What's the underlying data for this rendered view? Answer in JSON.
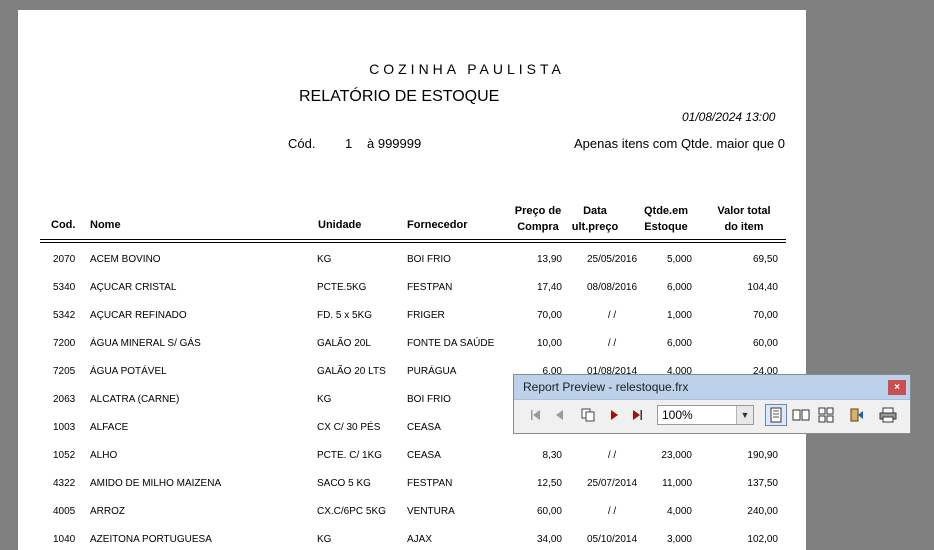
{
  "report": {
    "company": "COZINHA PAULISTA",
    "title": "RELATÓRIO DE ESTOQUE",
    "timestamp": "01/08/2024 13:00",
    "criteria_label": "Cód.",
    "criteria_from": "1",
    "criteria_to": "à 999999",
    "criteria_note": "Apenas itens com Qtde. maior que 0",
    "headers": {
      "cod": "Cod.",
      "nome": "Nome",
      "unidade": "Unidade",
      "fornecedor": "Fornecedor",
      "preco_1": "Preço de",
      "preco_2": "Compra",
      "data_1": "Data",
      "data_2": "ult.preço",
      "qtde_1": "Qtde.em",
      "qtde_2": "Estoque",
      "valor_1": "Valor total",
      "valor_2": "do item"
    },
    "rows": [
      {
        "cod": "2070",
        "nome": "ACEM BOVINO",
        "unidade": "KG",
        "fornecedor": "BOI FRIO",
        "preco": "13,90",
        "data": "25/05/2016",
        "qtde": "5,000",
        "valor": "69,50"
      },
      {
        "cod": "5340",
        "nome": "AÇUCAR CRISTAL",
        "unidade": "PCTE.5KG",
        "fornecedor": "FESTPAN",
        "preco": "17,40",
        "data": "08/08/2016",
        "qtde": "6,000",
        "valor": "104,40"
      },
      {
        "cod": "5342",
        "nome": "AÇUCAR REFINADO",
        "unidade": "FD. 5 x 5KG",
        "fornecedor": "FRIGER",
        "preco": "70,00",
        "data": "/  /",
        "qtde": "1,000",
        "valor": "70,00"
      },
      {
        "cod": "7200",
        "nome": "ÁGUA MINERAL S/ GÁS",
        "unidade": "GALÃO 20L",
        "fornecedor": "FONTE DA SAÚDE",
        "preco": "10,00",
        "data": "/  /",
        "qtde": "6,000",
        "valor": "60,00"
      },
      {
        "cod": "7205",
        "nome": "ÁGUA POTÁVEL",
        "unidade": "GALÃO 20 LTS",
        "fornecedor": "PURÁGUA",
        "preco": "6,00",
        "data": "01/08/2014",
        "qtde": "4,000",
        "valor": "24,00"
      },
      {
        "cod": "2063",
        "nome": "ALCATRA (CARNE)",
        "unidade": "KG",
        "fornecedor": "BOI FRIO",
        "preco": "",
        "data": "",
        "qtde": "",
        "valor": ""
      },
      {
        "cod": "1003",
        "nome": "ALFACE",
        "unidade": "CX C/ 30 PÉS",
        "fornecedor": "CEASA",
        "preco": "",
        "data": "",
        "qtde": "",
        "valor": ""
      },
      {
        "cod": "1052",
        "nome": "ALHO",
        "unidade": "PCTE. C/ 1KG",
        "fornecedor": "CEASA",
        "preco": "8,30",
        "data": "/  /",
        "qtde": "23,000",
        "valor": "190,90"
      },
      {
        "cod": "4322",
        "nome": "AMIDO DE MILHO MAIZENA",
        "unidade": "SACO 5 KG",
        "fornecedor": "FESTPAN",
        "preco": "12,50",
        "data": "25/07/2014",
        "qtde": "11,000",
        "valor": "137,50"
      },
      {
        "cod": "4005",
        "nome": "ARROZ",
        "unidade": "CX.C/6PC 5KG",
        "fornecedor": "VENTURA",
        "preco": "60,00",
        "data": "/  /",
        "qtde": "4,000",
        "valor": "240,00"
      },
      {
        "cod": "1040",
        "nome": "AZEITONA PORTUGUESA",
        "unidade": "KG",
        "fornecedor": "AJAX",
        "preco": "34,00",
        "data": "05/10/2014",
        "qtde": "3,000",
        "valor": "102,00"
      }
    ]
  },
  "toolbar": {
    "title": "Report Preview - relestoque.frx",
    "close": "×",
    "zoom": "100%",
    "icons": [
      "first-page-icon",
      "prev-page-icon",
      "copy-icon",
      "next-page-icon",
      "last-page-icon",
      "single-page-icon",
      "two-pages-icon",
      "four-pages-icon",
      "exit-icon",
      "print-icon"
    ]
  }
}
